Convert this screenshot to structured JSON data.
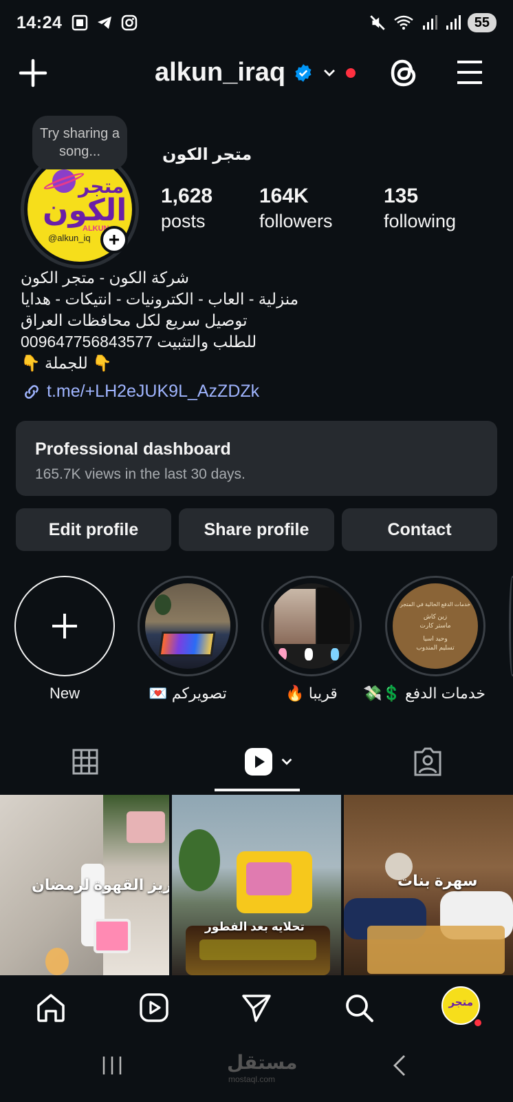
{
  "status_bar": {
    "time": "14:24",
    "icons_left": [
      "screen-record-icon",
      "telegram-icon",
      "instagram-icon"
    ],
    "icons_right": [
      "mute-icon",
      "wifi-icon",
      "signal-icon",
      "signal-icon"
    ],
    "battery": "55"
  },
  "header": {
    "username": "alkun_iraq",
    "verified": true,
    "icons": [
      "plus-icon",
      "verified-badge-icon",
      "chevron-down-icon",
      "notification-dot",
      "threads-icon",
      "menu-icon"
    ]
  },
  "profile": {
    "note_bubble": "Try sharing a song...",
    "avatar_text_line1": "متجر",
    "avatar_text_line2": "الكون",
    "avatar_text_latin": "ALKUN",
    "avatar_handle": "@alkun_iq",
    "display_name": "متجر الكون",
    "stats": [
      {
        "value": "1,628",
        "label": "posts"
      },
      {
        "value": "164K",
        "label": "followers"
      },
      {
        "value": "135",
        "label": "following"
      }
    ],
    "bio": [
      "شركة الكون  - متجر الكون",
      "منزلية - العاب - الكترونيات  - انتيكات - هدايا",
      "توصيل سريع لكل محافظات العراق",
      "للطلب والتثبيت 009647756843577",
      "👇 للجملة  👇"
    ],
    "link": "t.me/+LH2eJUK9L_AzZDZk"
  },
  "dashboard": {
    "title": "Professional dashboard",
    "subtitle": "165.7K views in the last 30 days."
  },
  "buttons": {
    "edit": "Edit profile",
    "share": "Share profile",
    "contact": "Contact"
  },
  "highlights": [
    {
      "label": "New"
    },
    {
      "label": "تصويركم 💌"
    },
    {
      "label": "قريبا 🔥"
    },
    {
      "label": "خدمات الدفع 💲💸"
    }
  ],
  "highlight_content": {
    "hl3_texts": [
      "خدمات الدفع الحالية في المتجر",
      "زين كاش",
      "ماستر كارت",
      "وحيد اسيا",
      "تسليم المندوب"
    ]
  },
  "tabs": [
    "grid-icon",
    "reels-icon",
    "tagged-icon"
  ],
  "grid_captions": [
    "تفريز القهوة لرمضان",
    "تحلايه بعد الفطور",
    "سهرة بنات"
  ],
  "bottom_nav": [
    "home-icon",
    "reels-icon",
    "send-icon",
    "search-icon",
    "profile-avatar"
  ],
  "watermark": {
    "text": "مستقل",
    "sub": "mostaql.com"
  }
}
